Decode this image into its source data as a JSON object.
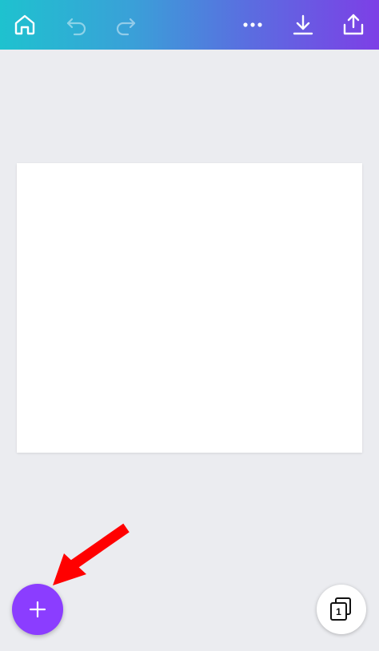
{
  "toolbar": {
    "gradient_start": "#1ec2cf",
    "gradient_end": "#7d3fe6",
    "buttons": [
      {
        "id": "home",
        "icon": "home-icon"
      },
      {
        "id": "undo",
        "icon": "undo-icon",
        "enabled": false
      },
      {
        "id": "redo",
        "icon": "redo-icon",
        "enabled": false
      },
      {
        "id": "more",
        "icon": "more-dots-icon"
      },
      {
        "id": "download",
        "icon": "download-icon"
      },
      {
        "id": "share",
        "icon": "share-upload-icon"
      }
    ]
  },
  "canvas": {
    "background": "#ebecf0",
    "page_color": "#ffffff"
  },
  "fab_add": {
    "icon": "plus-icon",
    "color": "#8b3dff"
  },
  "pages_button": {
    "icon": "pages-stack-icon",
    "page_count": "1"
  },
  "annotation": {
    "icon": "red-arrow-icon",
    "color": "#ff0000"
  }
}
